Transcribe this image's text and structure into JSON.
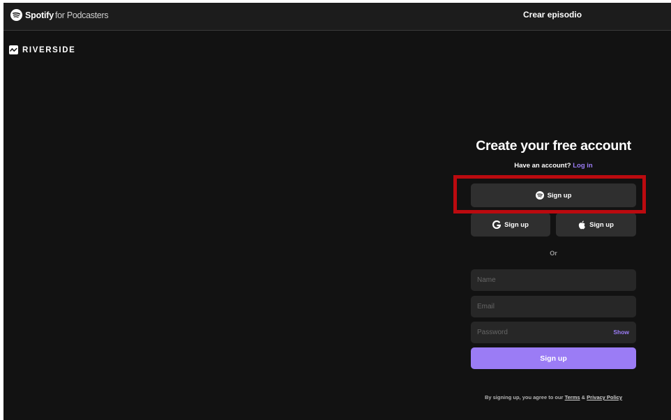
{
  "topbar": {
    "brand": "Spotify",
    "brand_suffix": "for Podcasters",
    "create_episode": "Crear episodio"
  },
  "logo": {
    "text": "RIVERSIDE",
    "icon": "riverside-wave-icon"
  },
  "signup": {
    "title": "Create your free account",
    "have_account": "Have an account?",
    "login": "Log in",
    "spotify_button": "Sign up",
    "google_button": "Sign up",
    "apple_button": "Sign up",
    "or": "Or",
    "name_placeholder": "Name",
    "email_placeholder": "Email",
    "password_placeholder": "Password",
    "show": "Show",
    "submit": "Sign up",
    "legal_prefix": "By signing up, you agree to our",
    "terms": "Terms",
    "amp": "&",
    "privacy": "Privacy Policy"
  },
  "colors": {
    "background": "#121212",
    "accent": "#9b7cf5",
    "highlight": "#bb0a0f",
    "button": "#2f2f2f"
  }
}
